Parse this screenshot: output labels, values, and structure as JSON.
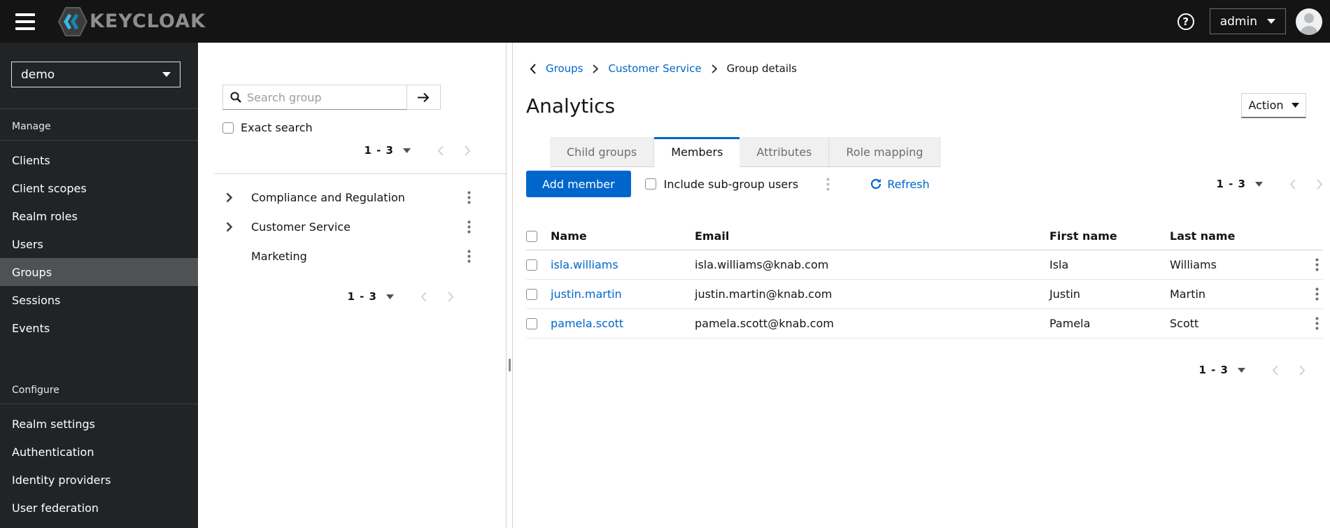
{
  "topbar": {
    "brand": "KEYCLOAK",
    "help_glyph": "?",
    "user": "admin"
  },
  "sidebar": {
    "realm": "demo",
    "manage": {
      "label": "Manage",
      "items": [
        "Clients",
        "Client scopes",
        "Realm roles",
        "Users",
        "Groups",
        "Sessions",
        "Events"
      ],
      "active_item": "Groups"
    },
    "configure": {
      "label": "Configure",
      "items": [
        "Realm settings",
        "Authentication",
        "Identity providers",
        "User federation"
      ]
    }
  },
  "group_panel": {
    "search_placeholder": "Search group",
    "exact_search_label": "Exact search",
    "pagination_top": "1 - 3",
    "tree": [
      {
        "label": "Compliance and Regulation",
        "expandable": true
      },
      {
        "label": "Customer Service",
        "expandable": true
      },
      {
        "label": "Marketing",
        "expandable": false
      }
    ],
    "pagination_bottom": "1 - 3"
  },
  "main": {
    "breadcrumb": {
      "items": [
        "Groups",
        "Customer Service",
        "Group details"
      ]
    },
    "title": "Analytics",
    "action_label": "Action",
    "tabs": [
      {
        "label": "Child groups",
        "active": false
      },
      {
        "label": "Members",
        "active": true
      },
      {
        "label": "Attributes",
        "active": false
      },
      {
        "label": "Role mapping",
        "active": false
      }
    ],
    "toolbar": {
      "add_member_label": "Add member",
      "include_subgroups_label": "Include sub-group users",
      "refresh_label": "Refresh",
      "pagination": "1 - 3"
    },
    "table": {
      "headers": [
        "Name",
        "Email",
        "First name",
        "Last name"
      ],
      "rows": [
        {
          "name": "isla.williams",
          "email": "isla.williams@knab.com",
          "first_name": "Isla",
          "last_name": "Williams"
        },
        {
          "name": "justin.martin",
          "email": "justin.martin@knab.com",
          "first_name": "Justin",
          "last_name": "Martin"
        },
        {
          "name": "pamela.scott",
          "email": "pamela.scott@knab.com",
          "first_name": "Pamela",
          "last_name": "Scott"
        }
      ]
    },
    "pagination_bottom": "1 - 3"
  },
  "colors": {
    "accent": "#0066cc",
    "link": "#0066cc",
    "masthead_bg": "#141414",
    "sidebar_bg": "#212427",
    "sidebar_active_bg": "#4f5255",
    "tab_inactive_bg": "#f0f0f0",
    "muted_text": "#6a6e73",
    "border": "#d2d2d2",
    "disabled": "#d2d2d2"
  }
}
